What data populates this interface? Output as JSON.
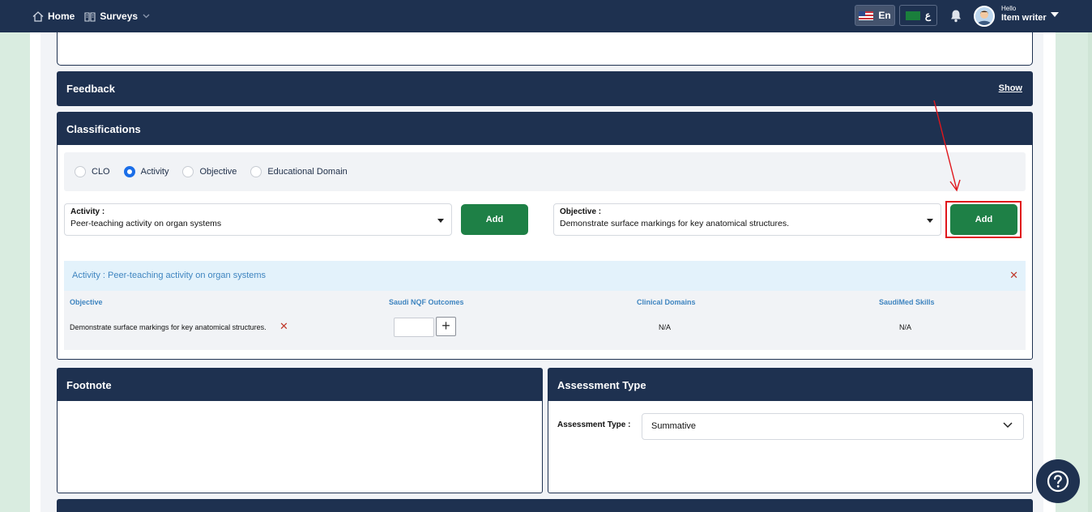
{
  "topbar": {
    "home_label": "Home",
    "surveys_label": "Surveys",
    "lang_en": "En",
    "lang_ar": "ع",
    "user_greeting": "Hello",
    "user_name": "Item writer"
  },
  "feedback": {
    "title": "Feedback",
    "show_label": "Show"
  },
  "classifications": {
    "title": "Classifications",
    "radios": [
      {
        "label": "CLO",
        "selected": false
      },
      {
        "label": "Activity",
        "selected": true
      },
      {
        "label": "Objective",
        "selected": false
      },
      {
        "label": "Educational Domain",
        "selected": false
      }
    ],
    "activity_select": {
      "label": "Activity :",
      "value": "Peer-teaching activity on organ systems"
    },
    "activity_add_label": "Add",
    "objective_select": {
      "label": "Objective :",
      "value": "Demonstrate surface markings for key anatomical structures."
    },
    "objective_add_label": "Add",
    "association": {
      "header": "Activity : Peer-teaching activity on organ systems",
      "columns": [
        "Objective",
        "Saudi NQF Outcomes",
        "Clinical Domains",
        "SaudiMed Skills"
      ],
      "row": {
        "objective": "Demonstrate surface markings for key anatomical structures.",
        "clinical_domains": "N/A",
        "saudimed_skills": "N/A"
      }
    }
  },
  "footnote": {
    "title": "Footnote"
  },
  "assessment": {
    "title": "Assessment Type",
    "label": "Assessment Type :",
    "value": "Summative"
  },
  "colors": {
    "navy": "#1e3150",
    "green": "#1e8046",
    "highlight_red": "#e0161b",
    "link_blue": "#3f85c0"
  }
}
